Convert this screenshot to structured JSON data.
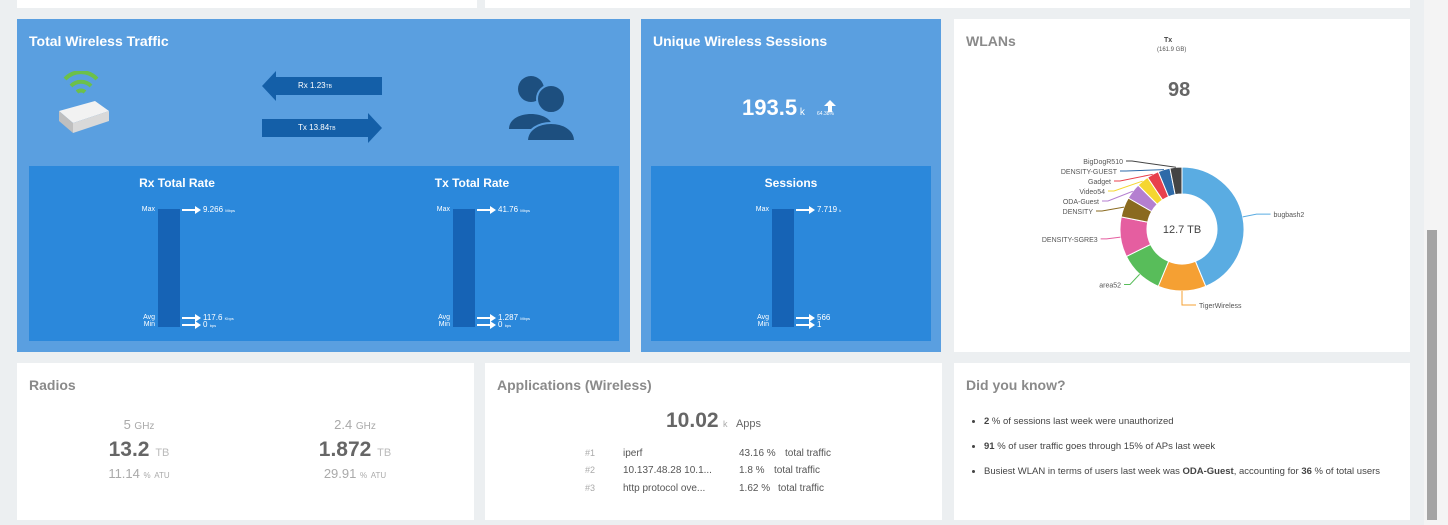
{
  "total_wireless_traffic": {
    "title": "Total Wireless Traffic",
    "rx_label": "Rx",
    "rx_value": "1.23",
    "rx_unit": "TB",
    "tx_label": "Tx",
    "tx_value": "13.84",
    "tx_unit": "TB",
    "rx_rate": {
      "title": "Rx Total Rate",
      "max_label": "Max",
      "avg_label": "Avg",
      "min_label": "Min",
      "max_value": "9.266",
      "max_unit": "Mbps",
      "avg_value": "117.6",
      "avg_unit": "Kbps",
      "min_value": "0",
      "min_unit": "bps"
    },
    "tx_rate": {
      "title": "Tx Total Rate",
      "max_label": "Max",
      "avg_label": "Avg",
      "min_label": "Min",
      "max_value": "41.76",
      "max_unit": "Mbps",
      "avg_value": "1.287",
      "avg_unit": "Mbps",
      "min_value": "0",
      "min_unit": "bps"
    },
    "icons": {
      "ap": "access-point-icon",
      "users": "users-icon"
    }
  },
  "unique_wireless_sessions": {
    "title": "Unique Wireless Sessions",
    "value": "193.5",
    "unit": "k",
    "trend": "64.38%",
    "trend_icon": "arrow-up-icon",
    "sessions": {
      "title": "Sessions",
      "max_label": "Max",
      "avg_label": "Avg",
      "min_label": "Min",
      "max_value": "7.719",
      "max_unit": "k",
      "avg_value": "566",
      "min_value": "1"
    }
  },
  "wlans": {
    "title": "WLANs",
    "metric_label": "Tx",
    "metric_sub": "(161.9 GB)",
    "count": "98",
    "center_label": "12.7 TB",
    "chart_data": {
      "type": "pie",
      "categories": [
        "bugbash2",
        "TigerWireless",
        "area52",
        "DENSITY-SGRE3",
        "DENSITY",
        "ODA-Guest",
        "Video54",
        "Gadget",
        "DENSITY-GUEST",
        "BigDogR510"
      ],
      "values": [
        42,
        12,
        11,
        10,
        5,
        4,
        3,
        3,
        3,
        3
      ],
      "colors": [
        "#5aace2",
        "#f5a033",
        "#58bd5a",
        "#e55ea0",
        "#8a6a1f",
        "#b47fd0",
        "#f5d630",
        "#e8404c",
        "#2e6aa8",
        "#444444"
      ]
    }
  },
  "radios": {
    "title": "Radios",
    "bands": [
      {
        "band": "5",
        "band_unit": "GHz",
        "value": "13.2",
        "unit": "TB",
        "atu": "11.14",
        "atu_pct": "%",
        "atu_label": "ATU"
      },
      {
        "band": "2.4",
        "band_unit": "GHz",
        "value": "1.872",
        "unit": "TB",
        "atu": "29.91",
        "atu_pct": "%",
        "atu_label": "ATU"
      }
    ]
  },
  "applications": {
    "title": "Applications (Wireless)",
    "count": "10.02",
    "count_unit": "k",
    "count_label": "Apps",
    "rows": [
      {
        "rank": "#1",
        "name": "iperf",
        "pct": "43.16 %",
        "label": "total traffic"
      },
      {
        "rank": "#2",
        "name": "10.137.48.28 10.1...",
        "pct": "1.8 %",
        "label": "total traffic"
      },
      {
        "rank": "#3",
        "name": "http protocol ove...",
        "pct": "1.62 %",
        "label": "total traffic"
      }
    ]
  },
  "did_you_know": {
    "title": "Did you know?",
    "items": [
      {
        "bold1": "2",
        "text1": " % of sessions last week were unauthorized"
      },
      {
        "bold1": "91",
        "text1": " % of user traffic goes through 15% of APs last week"
      },
      {
        "text0": "Busiest WLAN in terms of users last week was ",
        "bold1": "ODA-Guest",
        "text1": ", accounting for ",
        "bold2": "36",
        "text2": " % of total users"
      }
    ]
  }
}
